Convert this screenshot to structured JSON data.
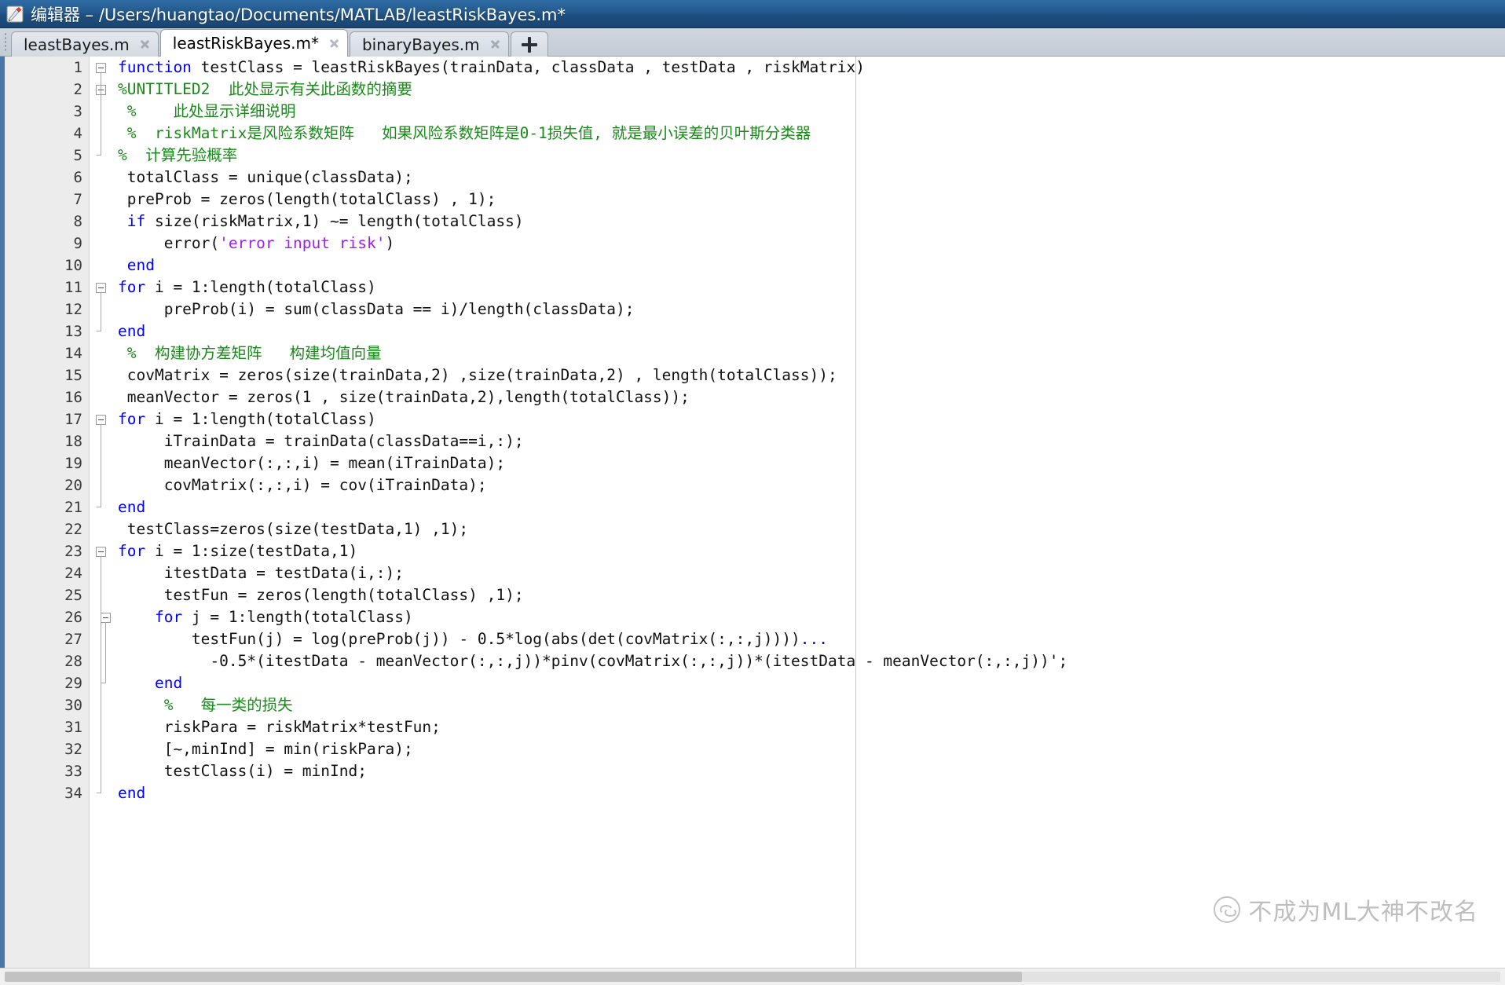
{
  "window": {
    "title": "编辑器 – /Users/huangtao/Documents/MATLAB/leastRiskBayes.m*",
    "icon": "matlab-editor-icon"
  },
  "tabs": [
    {
      "label": "leastBayes.m",
      "active": false,
      "modified": false
    },
    {
      "label": "leastRiskBayes.m*",
      "active": true,
      "modified": true
    },
    {
      "label": "binaryBayes.m",
      "active": false,
      "modified": false
    }
  ],
  "tabbar": {
    "add_tab_label": "+",
    "close_icon": "close-icon",
    "grip_icon": "drag-grip-icon"
  },
  "colors": {
    "keyword": "#0000ff",
    "comment": "#1a8a1a",
    "string": "#a020f0",
    "text": "#111111",
    "titlebar": "#24598c",
    "gutter": "#ececec",
    "gutter_accent": "#4a77a8",
    "ruler": "#c8c8c8"
  },
  "editor": {
    "filename": "leastRiskBayes.m",
    "language": "MATLAB",
    "lines": [
      {
        "num": "1",
        "exec": "",
        "fold": "open",
        "tokens": [
          {
            "t": "function ",
            "c": "kw"
          },
          {
            "t": "testClass = leastRiskBayes(trainData, classData , testData , riskMatrix)",
            "c": ""
          }
        ]
      },
      {
        "num": "2",
        "exec": "",
        "fold": "open",
        "tokens": [
          {
            "t": "%UNTITLED2  此处显示有关此函数的摘要",
            "c": "cmt"
          }
        ]
      },
      {
        "num": "3",
        "exec": "",
        "fold": "",
        "tokens": [
          {
            "t": " %    此处显示详细说明",
            "c": "cmt"
          }
        ]
      },
      {
        "num": "4",
        "exec": "",
        "fold": "",
        "tokens": [
          {
            "t": " %  riskMatrix是风险系数矩阵   如果风险系数矩阵是0-1损失值, 就是最小误差的贝叶斯分类器",
            "c": "cmt"
          }
        ]
      },
      {
        "num": "5",
        "exec": "",
        "fold": "close",
        "tokens": [
          {
            "t": "%  计算先验概率",
            "c": "cmt"
          }
        ]
      },
      {
        "num": "6",
        "exec": "-",
        "fold": "",
        "tokens": [
          {
            "t": " totalClass = unique(classData);",
            "c": ""
          }
        ]
      },
      {
        "num": "7",
        "exec": "-",
        "fold": "",
        "tokens": [
          {
            "t": " preProb = zeros(length(totalClass) , 1);",
            "c": ""
          }
        ]
      },
      {
        "num": "8",
        "exec": "-",
        "fold": "",
        "tokens": [
          {
            "t": " ",
            "c": ""
          },
          {
            "t": "if",
            "c": "kw"
          },
          {
            "t": " size(riskMatrix,1) ~= length(totalClass)",
            "c": ""
          }
        ]
      },
      {
        "num": "9",
        "exec": "-",
        "fold": "",
        "tokens": [
          {
            "t": "     error(",
            "c": ""
          },
          {
            "t": "'error input risk'",
            "c": "str"
          },
          {
            "t": ")",
            "c": ""
          }
        ]
      },
      {
        "num": "10",
        "exec": "-",
        "fold": "",
        "tokens": [
          {
            "t": " ",
            "c": ""
          },
          {
            "t": "end",
            "c": "kw"
          }
        ]
      },
      {
        "num": "11",
        "exec": "-",
        "fold": "open",
        "tokens": [
          {
            "t": "for",
            "c": "kw"
          },
          {
            "t": " i = 1:length(totalClass)",
            "c": ""
          }
        ]
      },
      {
        "num": "12",
        "exec": "-",
        "fold": "",
        "tokens": [
          {
            "t": "     preProb(i) = sum(classData == i)/length(classData);",
            "c": ""
          }
        ]
      },
      {
        "num": "13",
        "exec": "-",
        "fold": "close",
        "tokens": [
          {
            "t": "end",
            "c": "kw"
          }
        ]
      },
      {
        "num": "14",
        "exec": "",
        "fold": "",
        "tokens": [
          {
            "t": " %  构建协方差矩阵   构建均值向量",
            "c": "cmt"
          }
        ]
      },
      {
        "num": "15",
        "exec": "-",
        "fold": "",
        "tokens": [
          {
            "t": " covMatrix = zeros(size(trainData,2) ,size(trainData,2) , length(totalClass));",
            "c": ""
          }
        ]
      },
      {
        "num": "16",
        "exec": "-",
        "fold": "",
        "tokens": [
          {
            "t": " meanVector = zeros(1 , size(trainData,2),length(totalClass));",
            "c": ""
          }
        ]
      },
      {
        "num": "17",
        "exec": "-",
        "fold": "open",
        "tokens": [
          {
            "t": "for",
            "c": "kw"
          },
          {
            "t": " i = 1:length(totalClass)",
            "c": ""
          }
        ]
      },
      {
        "num": "18",
        "exec": "-",
        "fold": "",
        "tokens": [
          {
            "t": "     iTrainData = trainData(classData==i,:);",
            "c": ""
          }
        ]
      },
      {
        "num": "19",
        "exec": "-",
        "fold": "",
        "tokens": [
          {
            "t": "     meanVector(:,:,i) = mean(iTrainData);",
            "c": ""
          }
        ]
      },
      {
        "num": "20",
        "exec": "-",
        "fold": "",
        "tokens": [
          {
            "t": "     covMatrix(:,:,i) = cov(iTrainData);",
            "c": ""
          }
        ]
      },
      {
        "num": "21",
        "exec": "-",
        "fold": "close",
        "tokens": [
          {
            "t": "end",
            "c": "kw"
          }
        ]
      },
      {
        "num": "22",
        "exec": "-",
        "fold": "",
        "tokens": [
          {
            "t": " testClass=zeros(size(testData,1) ,1);",
            "c": ""
          }
        ]
      },
      {
        "num": "23",
        "exec": "-",
        "fold": "open",
        "tokens": [
          {
            "t": "for",
            "c": "kw"
          },
          {
            "t": " i = 1:size(testData,1)",
            "c": ""
          }
        ]
      },
      {
        "num": "24",
        "exec": "-",
        "fold": "",
        "tokens": [
          {
            "t": "     itestData = testData(i,:);",
            "c": ""
          }
        ]
      },
      {
        "num": "25",
        "exec": "-",
        "fold": "",
        "tokens": [
          {
            "t": "     testFun = zeros(length(totalClass) ,1);",
            "c": ""
          }
        ]
      },
      {
        "num": "26",
        "exec": "-",
        "fold": "open2",
        "tokens": [
          {
            "t": "    ",
            "c": ""
          },
          {
            "t": "for",
            "c": "kw"
          },
          {
            "t": " j = 1:length(totalClass)",
            "c": ""
          }
        ]
      },
      {
        "num": "27",
        "exec": "-",
        "fold": "",
        "tokens": [
          {
            "t": "        testFun(j) = log(preProb(j)) - 0.5*log(abs(det(covMatrix(:,:,j))))",
            "c": ""
          },
          {
            "t": "...",
            "c": "cont"
          }
        ]
      },
      {
        "num": "28",
        "exec": "",
        "fold": "",
        "tokens": [
          {
            "t": "          -0.5*(itestData - meanVector(:,:,j))*pinv(covMatrix(:,:,j))*(itestData - meanVector(:,:,j))';",
            "c": ""
          }
        ]
      },
      {
        "num": "29",
        "exec": "-",
        "fold": "close2",
        "tokens": [
          {
            "t": "    ",
            "c": ""
          },
          {
            "t": "end",
            "c": "kw"
          }
        ]
      },
      {
        "num": "30",
        "exec": "",
        "fold": "",
        "tokens": [
          {
            "t": "     %   每一类的损失",
            "c": "cmt"
          }
        ]
      },
      {
        "num": "31",
        "exec": "-",
        "fold": "",
        "tokens": [
          {
            "t": "     riskPara = riskMatrix*testFun;",
            "c": ""
          }
        ]
      },
      {
        "num": "32",
        "exec": "-",
        "fold": "",
        "tokens": [
          {
            "t": "     [~,minInd] = min(riskPara);",
            "c": ""
          }
        ]
      },
      {
        "num": "33",
        "exec": "-",
        "fold": "",
        "tokens": [
          {
            "t": "     testClass(i) = minInd;",
            "c": ""
          }
        ]
      },
      {
        "num": "34",
        "exec": "",
        "fold": "close",
        "tokens": [
          {
            "t": "end",
            "c": "kw"
          }
        ]
      }
    ]
  },
  "watermark": {
    "text": "不成为ML大神不改名",
    "logo": "wechat-icon"
  },
  "statusbar": {
    "hscroll": "horizontal-scrollbar"
  }
}
